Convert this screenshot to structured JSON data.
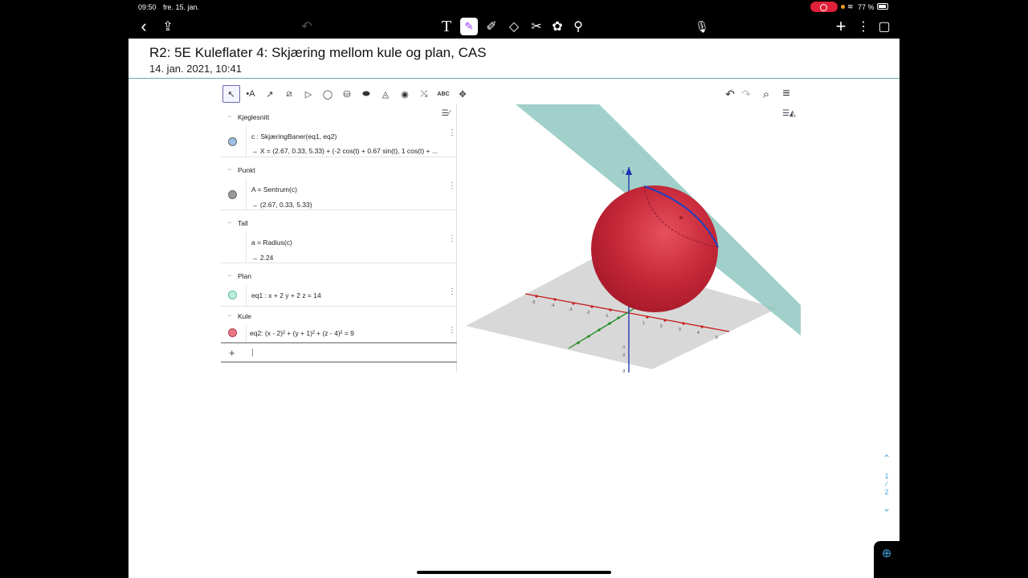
{
  "status_bar": {
    "time": "09:50",
    "date": "fre. 15. jan.",
    "battery": "77 %"
  },
  "app_toolbar": {
    "back": "‹",
    "share": "⇪",
    "undo": "↶",
    "text_tool": "T",
    "pen": "✎",
    "highlighter": "✐",
    "eraser": "◇",
    "lasso": "✂",
    "shapes": "✿",
    "elements": "⚲",
    "mic": "🎙",
    "add": "+",
    "more": "⋮",
    "pages": "▢"
  },
  "note": {
    "title": "R2: 5E Kuleflater 4: Skjæring mellom kule og plan, CAS",
    "date": "14. jan. 2021, 10:41"
  },
  "geogebra": {
    "tools": [
      "↖",
      "•A",
      "↗",
      "⧄",
      "▷",
      "◯",
      "⛁",
      "⬬",
      "◬",
      "◉",
      "⤯",
      "ABC",
      "✥"
    ],
    "undo": "↶",
    "redo": "↷",
    "search": "⌕",
    "menu": "≡",
    "sort_icon": "☰⁄",
    "categories": {
      "kjeglesnitt": "Kjeglesnitt",
      "punkt": "Punkt",
      "tall": "Tall",
      "plan": "Plan",
      "kule": "Kule"
    },
    "items": {
      "c_def": "c : SkjæringBaner(eq1, eq2)",
      "c_out": "→  X = (2.67, 0.33, 5.33) + (-2 cos(t) + 0.67 sin(t), 1 cos(t) + ...",
      "A_def": "A = Sentrum(c)",
      "A_out": "→  (2.67, 0.33, 5.33)",
      "a_def": "a = Radius(c)",
      "a_out": "→  2.24",
      "eq1_def": "eq1 : x + 2 y + 2 z = 14",
      "eq2_def": "eq2: (x - 2)² + (y + 1)² + (z - 4)² = 9"
    },
    "input_plus": "+",
    "input_caret": "|",
    "colors": {
      "sphere": "#c0283a",
      "plane": "#7fb8b0",
      "circle": "#2040c0",
      "point": "#808080"
    }
  },
  "page_nav": {
    "up": "⌃",
    "current": "1",
    "sep": "⁄",
    "total": "2",
    "down": "⌄",
    "zoom": "⊕"
  }
}
